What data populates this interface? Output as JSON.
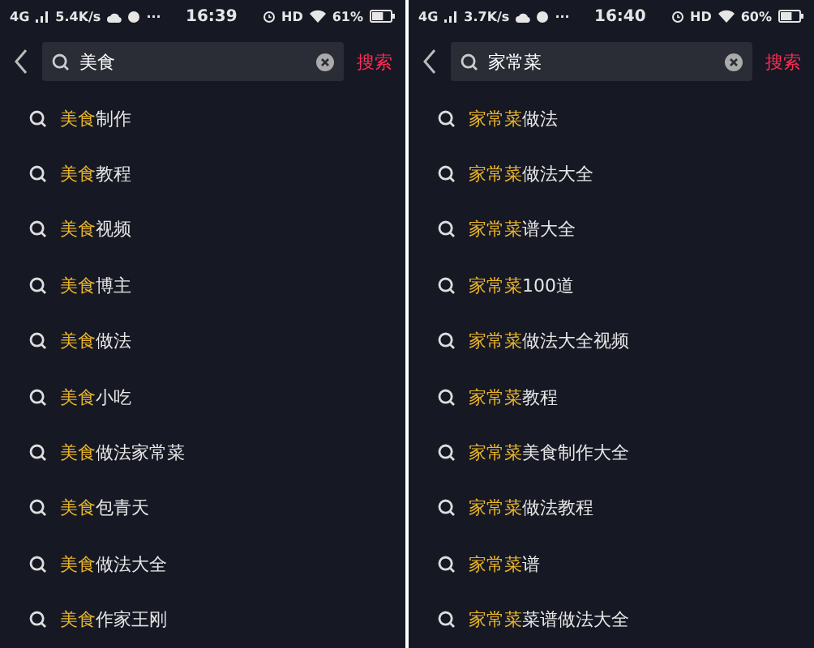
{
  "screens": [
    {
      "status_bar": {
        "network": "4G",
        "speed": "5.4K/s",
        "more": "···",
        "time": "16:39",
        "hd": "HD",
        "battery": "61%"
      },
      "search": {
        "query": "美食",
        "button": "搜索"
      },
      "suggestions": [
        {
          "match": "美食",
          "rest": "制作"
        },
        {
          "match": "美食",
          "rest": "教程"
        },
        {
          "match": "美食",
          "rest": "视频"
        },
        {
          "match": "美食",
          "rest": "博主"
        },
        {
          "match": "美食",
          "rest": "做法"
        },
        {
          "match": "美食",
          "rest": "小吃"
        },
        {
          "match": "美食",
          "rest": "做法家常菜"
        },
        {
          "match": "美食",
          "rest": "包青天"
        },
        {
          "match": "美食",
          "rest": "做法大全"
        },
        {
          "match": "美食",
          "rest": "作家王刚"
        }
      ]
    },
    {
      "status_bar": {
        "network": "4G",
        "speed": "3.7K/s",
        "more": "···",
        "time": "16:40",
        "hd": "HD",
        "battery": "60%"
      },
      "search": {
        "query": "家常菜",
        "button": "搜索"
      },
      "suggestions": [
        {
          "match": "家常菜",
          "rest": "做法"
        },
        {
          "match": "家常菜",
          "rest": "做法大全"
        },
        {
          "match": "家常菜",
          "rest": "谱大全"
        },
        {
          "match": "家常菜",
          "rest": "100道"
        },
        {
          "match": "家常菜",
          "rest": "做法大全视频"
        },
        {
          "match": "家常菜",
          "rest": "教程"
        },
        {
          "match": "家常菜",
          "rest": "美食制作大全"
        },
        {
          "match": "家常菜",
          "rest": "做法教程"
        },
        {
          "match": "家常菜",
          "rest": "谱"
        },
        {
          "match": "家常菜",
          "rest": "菜谱做法大全"
        }
      ]
    }
  ]
}
